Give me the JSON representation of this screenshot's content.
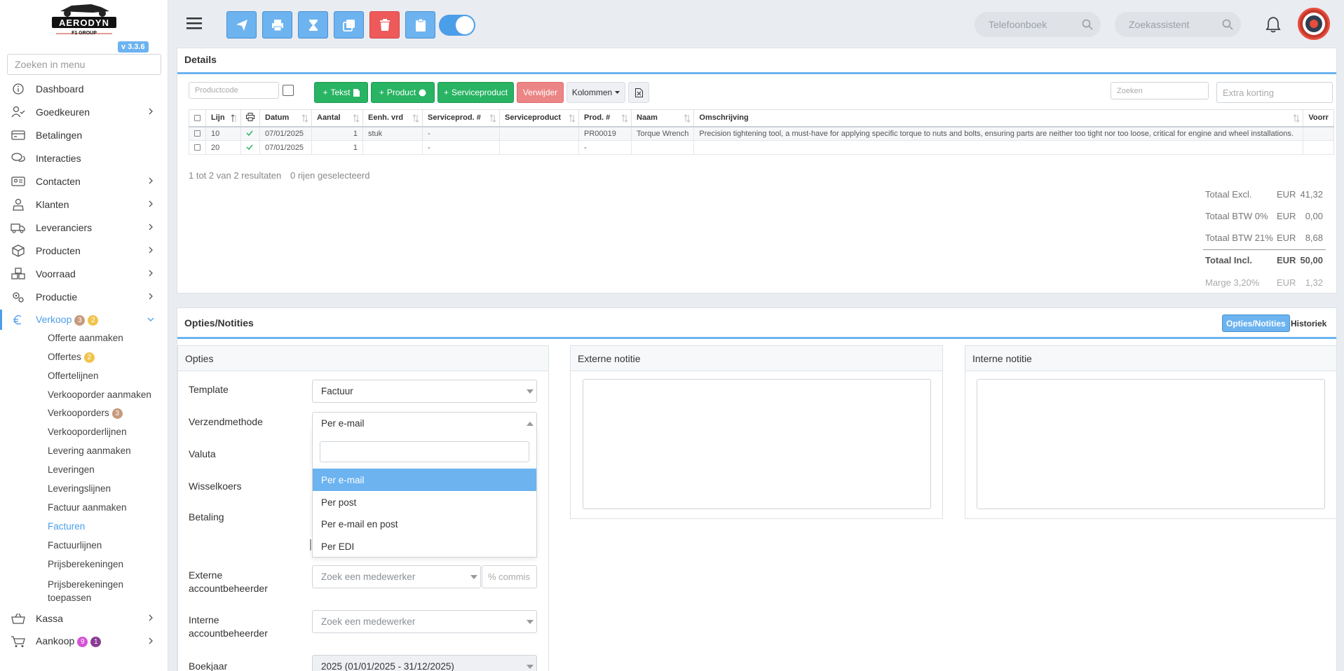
{
  "app": {
    "brand": "AERODYN",
    "brand_sub": "F1 GROUP",
    "version": "v 3.3.6"
  },
  "sidebar": {
    "search_placeholder": "Zoeken in menu",
    "items": [
      {
        "label": "Dashboard",
        "icon": "info-circle-icon"
      },
      {
        "label": "Goedkeuren",
        "icon": "user-check-icon"
      },
      {
        "label": "Betalingen",
        "icon": "credit-card-icon"
      },
      {
        "label": "Interacties",
        "icon": "chat-icon"
      },
      {
        "label": "Contacten",
        "icon": "id-card-icon"
      },
      {
        "label": "Klanten",
        "icon": "user-tie-icon"
      },
      {
        "label": "Leveranciers",
        "icon": "truck-icon"
      },
      {
        "label": "Producten",
        "icon": "box-icon"
      },
      {
        "label": "Voorraad",
        "icon": "boxes-icon"
      },
      {
        "label": "Productie",
        "icon": "gears-icon"
      },
      {
        "label": "Verkoop",
        "icon": "euro-icon",
        "badges": [
          "3",
          "2"
        ]
      },
      {
        "label": "Kassa",
        "icon": "basket-icon"
      },
      {
        "label": "Aankoop",
        "icon": "cart-icon",
        "badges": [
          "9",
          "1"
        ]
      }
    ],
    "verkoop_sub": [
      {
        "label": "Offerte aanmaken"
      },
      {
        "label": "Offertes",
        "badge": "2"
      },
      {
        "label": "Offertelijnen"
      },
      {
        "label": "Verkooporder aanmaken"
      },
      {
        "label": "Verkooporders",
        "badge": "3"
      },
      {
        "label": "Verkooporderlijnen"
      },
      {
        "label": "Levering aanmaken"
      },
      {
        "label": "Leveringen"
      },
      {
        "label": "Leveringslijnen"
      },
      {
        "label": "Factuur aanmaken"
      },
      {
        "label": "Facturen"
      },
      {
        "label": "Factuurlijnen"
      },
      {
        "label": "Prijsberekeningen"
      },
      {
        "label": "Prijsberekeningen toepassen"
      }
    ]
  },
  "topbar": {
    "phonebook_placeholder": "Telefoonboek",
    "assistant_placeholder": "Zoekassistent"
  },
  "details": {
    "title": "Details",
    "productcode_placeholder": "Productcode",
    "btn_tekst": "Tekst",
    "btn_product": "Product",
    "btn_serviceproduct": "Serviceproduct",
    "btn_verwijder": "Verwijder",
    "btn_kolommen": "Kolommen",
    "search_placeholder": "Zoeken",
    "discount_placeholder": "Extra korting",
    "columns": [
      "Lijn",
      "Datum",
      "Aantal",
      "Eenh. vrd",
      "Serviceprod. #",
      "Serviceproduct",
      "Prod. #",
      "Naam",
      "Omschrijving",
      "Voorr"
    ],
    "rows": [
      {
        "lijn": "10",
        "datum": "07/01/2025",
        "aantal": "1",
        "eenh": "stuk",
        "servprodnr": "-",
        "servprod": "",
        "prodnr": "PR00019",
        "naam": "Torque Wrench",
        "omschrijving": "Precision tightening tool, a must-have for applying specific torque to nuts and bolts, ensuring parts are neither too tight nor too loose, critical for engine and wheel installations."
      },
      {
        "lijn": "20",
        "datum": "07/01/2025",
        "aantal": "1",
        "eenh": "",
        "servprodnr": "-",
        "servprod": "",
        "prodnr": "-",
        "naam": "",
        "omschrijving": ""
      }
    ],
    "result_info": "1 tot 2 van 2 resultaten",
    "selected_info": "0 rijen geselecteerd",
    "totals": [
      {
        "label": "Totaal Excl.",
        "cur": "EUR",
        "value": "41,32"
      },
      {
        "label": "Totaal BTW 0%",
        "cur": "EUR",
        "value": "0,00"
      },
      {
        "label": "Totaal BTW 21%",
        "cur": "EUR",
        "value": "8,68"
      },
      {
        "label": "Totaal Incl.",
        "cur": "EUR",
        "value": "50,00"
      },
      {
        "label": "Marge 3,20%",
        "cur": "EUR",
        "value": "1,32"
      }
    ]
  },
  "options": {
    "title": "Opties/Notities",
    "tab_active": "Opties/Notities",
    "tab_other": "Historiek",
    "opties_title": "Opties",
    "externe_title": "Externe notitie",
    "interne_title": "Interne notitie",
    "labels": {
      "template": "Template",
      "verzend": "Verzendmethode",
      "valuta": "Valuta",
      "wissel": "Wisselkoers",
      "betaling": "Betaling",
      "ext_acc": "Externe accountbeheerder",
      "int_acc": "Interne accountbeheerder",
      "boekjaar": "Boekjaar"
    },
    "template_value": "Factuur",
    "verzend_value": "Per e-mail",
    "verzend_options": [
      "Per e-mail",
      "Per post",
      "Per e-mail en post",
      "Per EDI"
    ],
    "employee_placeholder": "Zoek een medewerker",
    "commission_placeholder": "% commis",
    "boekjaar_value": "2025 (01/01/2025 - 31/12/2025)"
  }
}
